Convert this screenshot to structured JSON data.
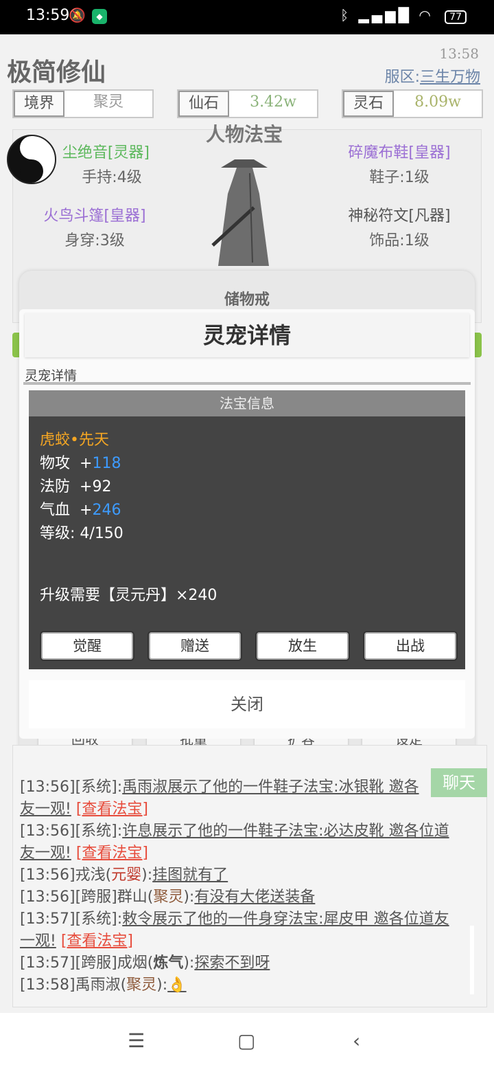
{
  "status_bar": {
    "time": "13:59",
    "battery": "77"
  },
  "header": {
    "title": "极简修仙",
    "clock": "13:58",
    "server_label": "服区:",
    "server_name": "三生万物"
  },
  "stats": [
    {
      "label": "境界",
      "value": "聚灵"
    },
    {
      "label": "仙石",
      "value": "3.42w"
    },
    {
      "label": "灵石",
      "value": "8.09w"
    }
  ],
  "equipment": {
    "section_title": "人物法宝",
    "items": [
      {
        "name": "尘绝音[灵器]",
        "slot": "手持:4级"
      },
      {
        "name": "碎魔布鞋[皇器]",
        "slot": "鞋子:1级"
      },
      {
        "name": "火鸟斗篷[皇器]",
        "slot": "身穿:3级"
      },
      {
        "name": "神秘符文[凡器]",
        "slot": "饰品:1级"
      }
    ]
  },
  "storage_modal": {
    "title": "储物戒"
  },
  "pet_modal": {
    "title": "灵宠详情",
    "tab": "灵宠详情",
    "panel_header": "法宝信息",
    "pet_name": "虎蛟•先天",
    "stats": [
      {
        "label": "物攻",
        "prefix": "+",
        "value": "118",
        "highlight": true
      },
      {
        "label": "法防",
        "prefix": "+",
        "value": "92",
        "highlight": false
      },
      {
        "label": "气血",
        "prefix": "+",
        "value": "246",
        "highlight": true
      }
    ],
    "level": "等级: 4/150",
    "upgrade": "升级需要【灵元丹】×240",
    "buttons": [
      "觉醒",
      "赠送",
      "放生",
      "出战"
    ],
    "close": "关闭"
  },
  "background_buttons": [
    "回收",
    "批量",
    "扩容",
    "设定"
  ],
  "chat": {
    "button": "聊天",
    "lines": [
      {
        "prefix": "[13:56][系统]:",
        "body": "禹雨淑展示了他的一件鞋子法宝:冰银靴 邀各",
        "link": ""
      },
      {
        "prefix": "",
        "body": "友一观!",
        "link": "[查看法宝]"
      },
      {
        "prefix": "[13:56][系统]:",
        "body": "许息展示了他的一件鞋子法宝:必达皮靴 邀各位道",
        "link": ""
      },
      {
        "prefix": "",
        "body": "友一观!",
        "link": "[查看法宝]"
      },
      {
        "prefix": "[13:56]戎浅(",
        "realm": "元婴",
        "suffix": "):",
        "body": "挂图就有了"
      },
      {
        "prefix": "[13:56][跨服]群山(",
        "realm": "聚灵",
        "suffix": "):",
        "body": "有没有大佬送装备"
      },
      {
        "prefix": "[13:57][系统]:",
        "body": "敕令展示了他的一件身穿法宝:犀皮甲 邀各位道友",
        "link": ""
      },
      {
        "prefix": "",
        "body": "一观!",
        "link": "[查看法宝]"
      },
      {
        "prefix": "[13:57][跨服]成烟(",
        "realm": "炼气",
        "suffix": "):",
        "body": "探索不到呀"
      },
      {
        "prefix": "[13:58]禹雨淑(",
        "realm": "聚灵",
        "suffix": "):",
        "body": "👌"
      }
    ]
  },
  "colors": {
    "green_item": "#5cb85c",
    "purple_item": "#9b6fd4",
    "info_bg": "#444444",
    "accent_blue": "#3d9bff",
    "pet_name": "#f5a623"
  }
}
